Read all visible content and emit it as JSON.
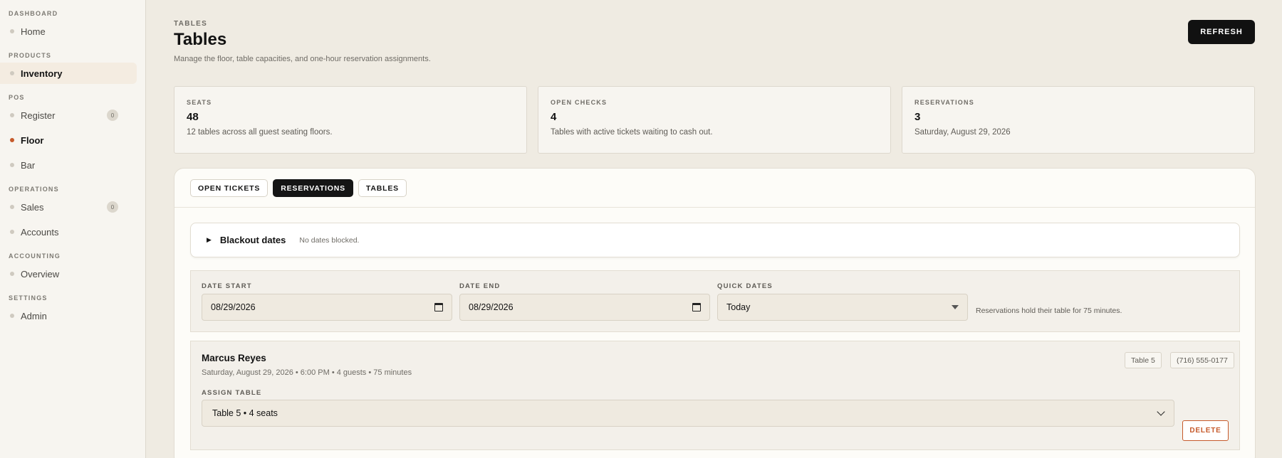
{
  "sidebar": {
    "sections": [
      {
        "title": "DASHBOARD",
        "items": [
          {
            "label": "Home"
          }
        ]
      },
      {
        "title": "PRODUCTS",
        "items": [
          {
            "label": "Inventory"
          }
        ]
      },
      {
        "title": "POS",
        "items": [
          {
            "label": "Register",
            "badge": "0"
          },
          {
            "label": "Floor"
          },
          {
            "label": "Bar"
          }
        ]
      },
      {
        "title": "OPERATIONS",
        "items": [
          {
            "label": "Sales",
            "badge": "0"
          },
          {
            "label": "Accounts"
          }
        ]
      },
      {
        "title": "ACCOUNTING",
        "items": [
          {
            "label": "Overview"
          }
        ]
      },
      {
        "title": "SETTINGS",
        "items": [
          {
            "label": "Admin"
          }
        ]
      }
    ]
  },
  "header": {
    "eyebrow": "TABLES",
    "title": "Tables",
    "subtitle": "Manage the floor, table capacities, and one-hour reservation assignments.",
    "refresh_label": "REFRESH"
  },
  "stats": [
    {
      "label": "SEATS",
      "value": "48",
      "desc": "12 tables across all guest seating floors."
    },
    {
      "label": "OPEN CHECKS",
      "value": "4",
      "desc": "Tables with active tickets waiting to cash out."
    },
    {
      "label": "RESERVATIONS",
      "value": "3",
      "desc": "Saturday, August 29, 2026"
    }
  ],
  "tabs": [
    {
      "label": "OPEN TICKETS",
      "active": false
    },
    {
      "label": "RESERVATIONS",
      "active": true
    },
    {
      "label": "TABLES",
      "active": false
    }
  ],
  "blackout": {
    "title": "Blackout dates",
    "note": "No dates blocked."
  },
  "filters": {
    "date_start_label": "DATE START",
    "date_start_value": "08/29/2026",
    "date_end_label": "DATE END",
    "date_end_value": "08/29/2026",
    "quick_dates_label": "QUICK DATES",
    "quick_dates_value": "Today",
    "note": "Reservations hold their table for 75 minutes."
  },
  "reservation": {
    "name": "Marcus Reyes",
    "meta": "Saturday, August 29, 2026 • 6:00 PM • 4 guests • 75 minutes",
    "table_pill": "Table 5",
    "phone_pill": "(716) 555-0177",
    "assign_label": "ASSIGN TABLE",
    "assign_value": "Table 5 • 4 seats",
    "delete_label": "DELETE"
  },
  "colors": {
    "accent": "#c65a2b",
    "primary_button": "#111111",
    "background": "#efebe2"
  }
}
